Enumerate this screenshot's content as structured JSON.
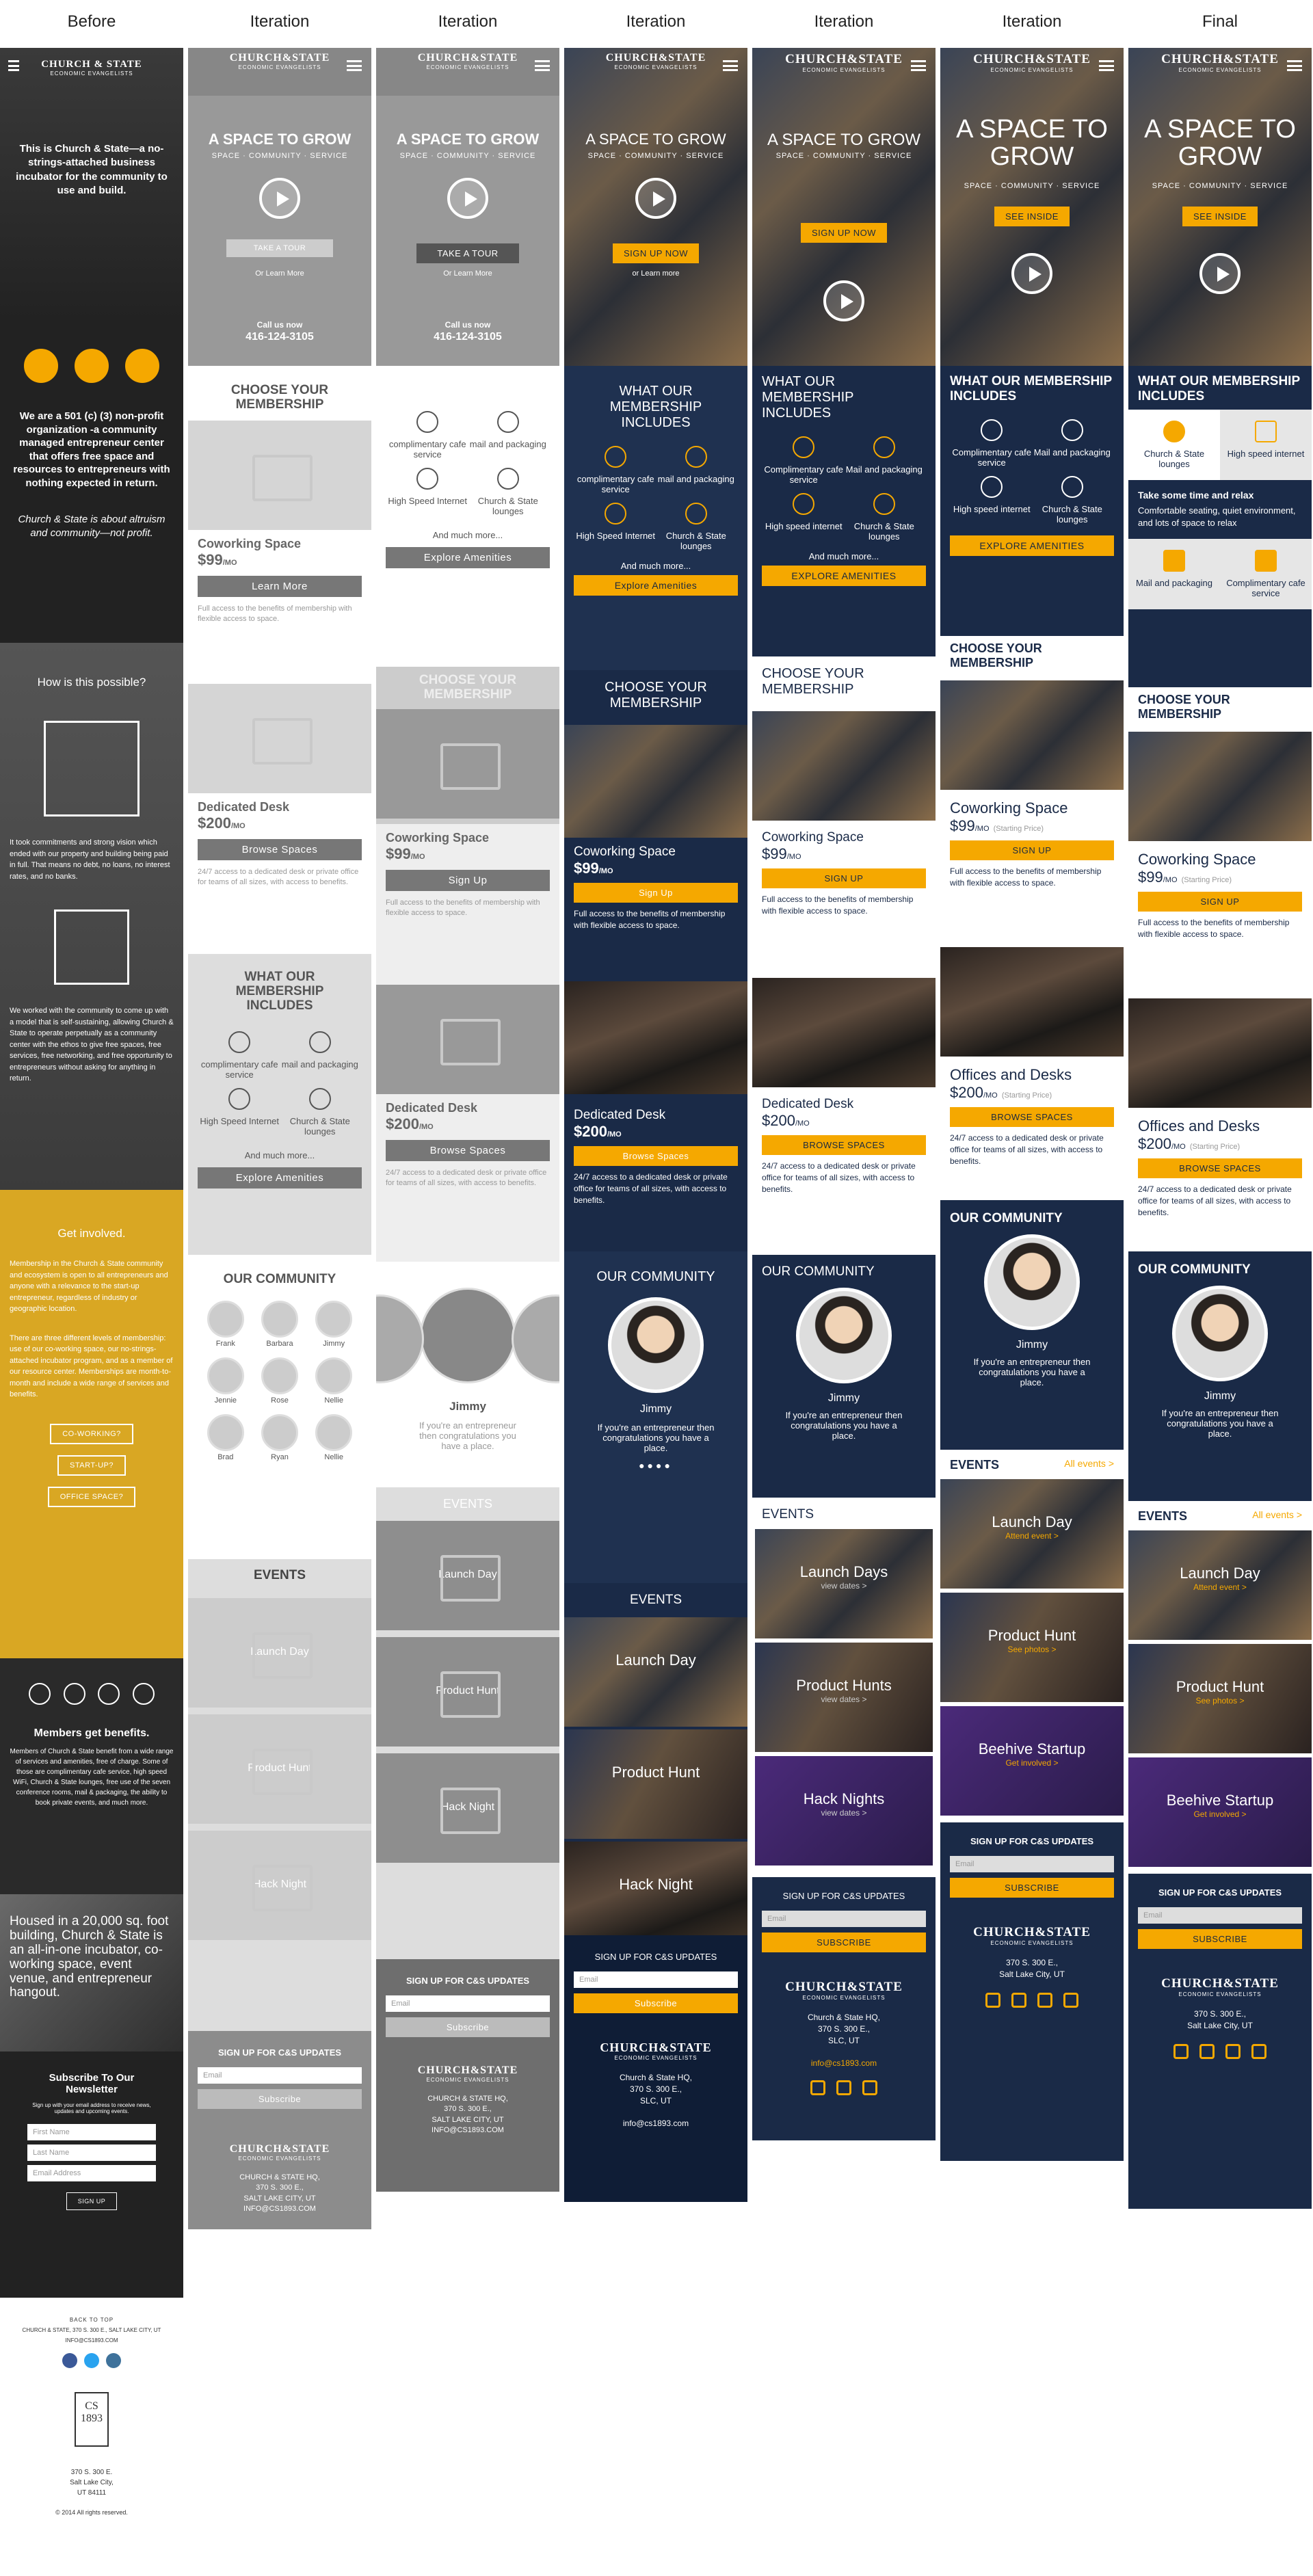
{
  "headers": [
    "Before",
    "Iteration",
    "Iteration",
    "Iteration",
    "Iteration",
    "Iteration",
    "Final"
  ],
  "before": {
    "logo": "CHURCH & STATE",
    "logo_sub": "ECONOMIC EVANGELISTS",
    "hero": "This is Church & State—a no-strings-attached business incubator for the community to use and build.",
    "about": "We are a 501 (c) (3) non-profit organization -a community managed entrepreneur center that offers free space and resources to entrepreneurs with nothing expected in return.",
    "quote": "Church & State is about altruism and community—not profit.",
    "how_title": "How is this possible?",
    "how_text1": "It took commitments and strong vision which ended with our property and building being paid in full. That means no debt, no loans, no interest rates, and no banks.",
    "how_text2": "We worked with the community to come up with a model that is self-sustaining, allowing Church & State to operate perpetually as a community center with the ethos to give free spaces, free services, free networking, and free opportunity to entrepreneurs without asking for anything in return.",
    "involved_title": "Get involved.",
    "involved_text": "Membership in the Church & State community and ecosystem is open to all entrepreneurs and anyone with a relevance to the start-up entrepreneur, regardless of industry or geographic location.",
    "involved_text2": "There are three different levels of membership: use of our co-working space, our no-strings-attached incubator program, and as a member of our resource center. Memberships are month-to-month and include a wide range of services and benefits.",
    "btn1": "CO-WORKING?",
    "btn2": "START-UP?",
    "btn3": "OFFICE SPACE?",
    "benefits_title": "Members get benefits.",
    "benefits_text": "Members of Church & State benefit from a wide range of services and amenities, free of charge. Some of those are complimentary cafe service, high speed WiFi, Church & State lounges, free use of the seven conference rooms, mail & packaging, the ability to book private events, and much more.",
    "housed": "Housed in a 20,000 sq. foot building, Church & State is an all-in-one incubator, co-working space, event venue, and entrepreneur hangout.",
    "newsletter_title": "Subscribe To Our Newsletter",
    "newsletter_text": "Sign up with your email address to receive news, updates and upcoming events.",
    "f1": "First Name",
    "f2": "Last Name",
    "f3": "Email Address",
    "signup": "SIGN UP",
    "back": "BACK TO TOP",
    "addr": "CHURCH & STATE, 370 S. 300 E., SALT LAKE CITY, UT",
    "email": "INFO@CS1893.COM",
    "addr2": "370 S. 300 E.",
    "addr3": "Salt Lake City,",
    "addr4": "UT 84111",
    "copy": "© 2014 All rights reserved.",
    "mark1": "CS",
    "mark2": "1893"
  },
  "it1": {
    "hero": "A SPACE TO GROW",
    "sub": "SPACE · COMMUNITY · SERVICE",
    "tour": "TAKE A TOUR",
    "learn": "Or Learn More",
    "call": "Call us now",
    "phone": "416-124-3105",
    "choose": "CHOOSE YOUR MEMBERSHIP",
    "cw": "Coworking Space",
    "cw_price": "$99",
    "mo": "/MO",
    "learn_more": "Learn More",
    "cw_desc": "Full access to the benefits of membership with flexible access to space.",
    "dd": "Dedicated Desk",
    "dd_price": "$200",
    "browse": "Browse Spaces",
    "dd_desc": "24/7 access to a dedicated desk or private office for teams of all sizes, with access to benefits.",
    "incl": "WHAT OUR MEMBERSHIP INCLUDES",
    "a1": "complimentary cafe service",
    "a2": "mail and packaging",
    "a3": "High Speed Internet",
    "a4": "Church & State lounges",
    "more": "And much more...",
    "explore": "Explore Amenities",
    "community": "OUR COMMUNITY",
    "people": [
      "Frank",
      "Barbara",
      "Jimmy",
      "Jennie",
      "Rose",
      "Nellie",
      "Brad",
      "Ryan",
      "Nellie"
    ],
    "events": "EVENTS",
    "e1": "Launch Day",
    "e2": "Product Hunt",
    "e3": "Hack Night",
    "signup": "SIGN UP FOR C&S UPDATES",
    "email": "Email",
    "subscribe": "Subscribe",
    "addr": "CHURCH & STATE HQ,",
    "addr2": "370 S. 300 E.,",
    "addr3": "SALT LAKE CITY, UT",
    "addr4": "INFO@CS1893.COM"
  },
  "it2": {
    "jimmy": "Jimmy",
    "quote": "If you're an entrepreneur then congratulations you have a place.",
    "cw": "Coworking Space",
    "price": "$99",
    "signup": "Sign Up",
    "dd": "Dedicated Desk",
    "dd_price": "$200",
    "events": "EVENTS"
  },
  "it3": {
    "signup_now": "SIGN UP NOW",
    "or_learn": "or Learn more",
    "incl": "WHAT OUR MEMBERSHIP INCLUDES",
    "choose": "CHOOSE YOUR MEMBERSHIP",
    "cw": "Coworking Space",
    "price": "$99",
    "signup": "Sign Up",
    "browse": "Browse Spaces",
    "email_addr": "info@cs1893.com",
    "addr": "Church & State HQ,",
    "addr2": "370 S. 300 E.,",
    "addr3": "SLC, UT",
    "e1": "Launch Day",
    "e2": "Product Hunt",
    "e3": "Hack Night",
    "community": "OUR COMMUNITY"
  },
  "it4": {
    "incl": "WHAT OUR MEMBERSHIP INCLUDES",
    "a1": "Complimentary cafe service",
    "a2": "Mail and packaging",
    "a3": "High speed internet",
    "a4": "Church & State lounges",
    "more": "And much more...",
    "explore": "EXPLORE AMENITIES",
    "choose": "CHOOSE YOUR MEMBERSHIP",
    "signup": "SIGN UP",
    "browse": "BROWSE SPACES",
    "e1": "Launch Days",
    "e2": "Product Hunts",
    "e3": "Hack Nights",
    "view": "view dates >",
    "subscribe": "SUBSCRIBE",
    "email_addr": "info@cs1893.com"
  },
  "it5": {
    "see": "SEE INSIDE",
    "od": "Offices and Desks",
    "price_note": "(Starting Price)",
    "all": "All events >",
    "e4": "Beehive Startup",
    "attend": "Attend event >",
    "photos": "See photos >",
    "involved": "Get involved >",
    "addr4": "Salt Lake City, UT"
  },
  "final": {
    "title": "A SPACE TO GROW",
    "sub": "SPACE · COMMUNITY · SERVICE",
    "relax": "Take some time and relax",
    "relax_desc": "Comfortable seating, quiet environment, and lots of space to relax",
    "mp": "Mail and packaging",
    "cs": "Complimentary cafe service"
  }
}
